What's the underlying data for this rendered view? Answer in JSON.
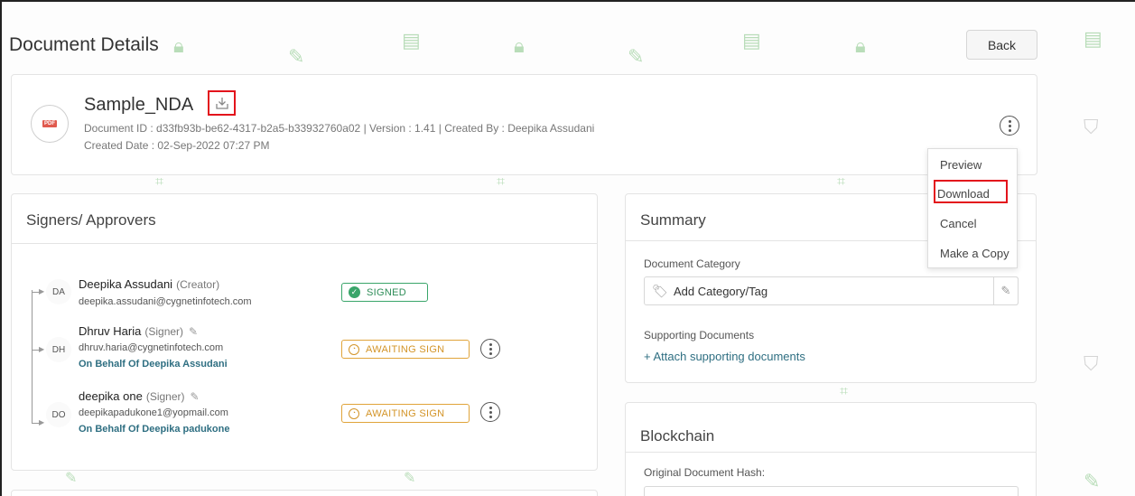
{
  "page": {
    "title": "Document Details",
    "back_label": "Back"
  },
  "document": {
    "name": "Sample_NDA",
    "file_badge": "PDF",
    "meta": "Document ID : d33fb93b-be62-4317-b2a5-b33932760a02  |  Version : 1.41  |  Created By : Deepika Assudani",
    "created": "Created Date : 02-Sep-2022 07:27 PM"
  },
  "actions_menu": {
    "items": [
      "Preview",
      "Download",
      "Cancel",
      "Make a Copy"
    ],
    "highlighted": "Download"
  },
  "signers": {
    "title": "Signers/ Approvers",
    "list": [
      {
        "initials": "DA",
        "name": "Deepika Assudani",
        "role": "(Creator)",
        "email": "deepika.assudani@cygnetinfotech.com",
        "behalf": "",
        "status": "SIGNED"
      },
      {
        "initials": "DH",
        "name": "Dhruv Haria",
        "role": "(Signer)",
        "email": "dhruv.haria@cygnetinfotech.com",
        "behalf": "On Behalf Of Deepika Assudani",
        "status": "AWAITING SIGN"
      },
      {
        "initials": "DO",
        "name": "deepika one",
        "role": "(Signer)",
        "email": "deepikapadukone1@yopmail.com",
        "behalf": "On Behalf Of Deepika padukone",
        "status": "AWAITING SIGN"
      }
    ]
  },
  "summary": {
    "title": "Summary",
    "category_label": "Document Category",
    "category_placeholder": "Add Category/Tag",
    "supporting_label": "Supporting Documents",
    "attach_link": "+ Attach supporting documents"
  },
  "blockchain": {
    "title": "Blockchain",
    "hash_label": "Original Document Hash:"
  },
  "colors": {
    "signed": "#3aa56a",
    "awaiting": "#e0a43a",
    "highlight": "#e3141c",
    "link": "#2f6f82"
  }
}
